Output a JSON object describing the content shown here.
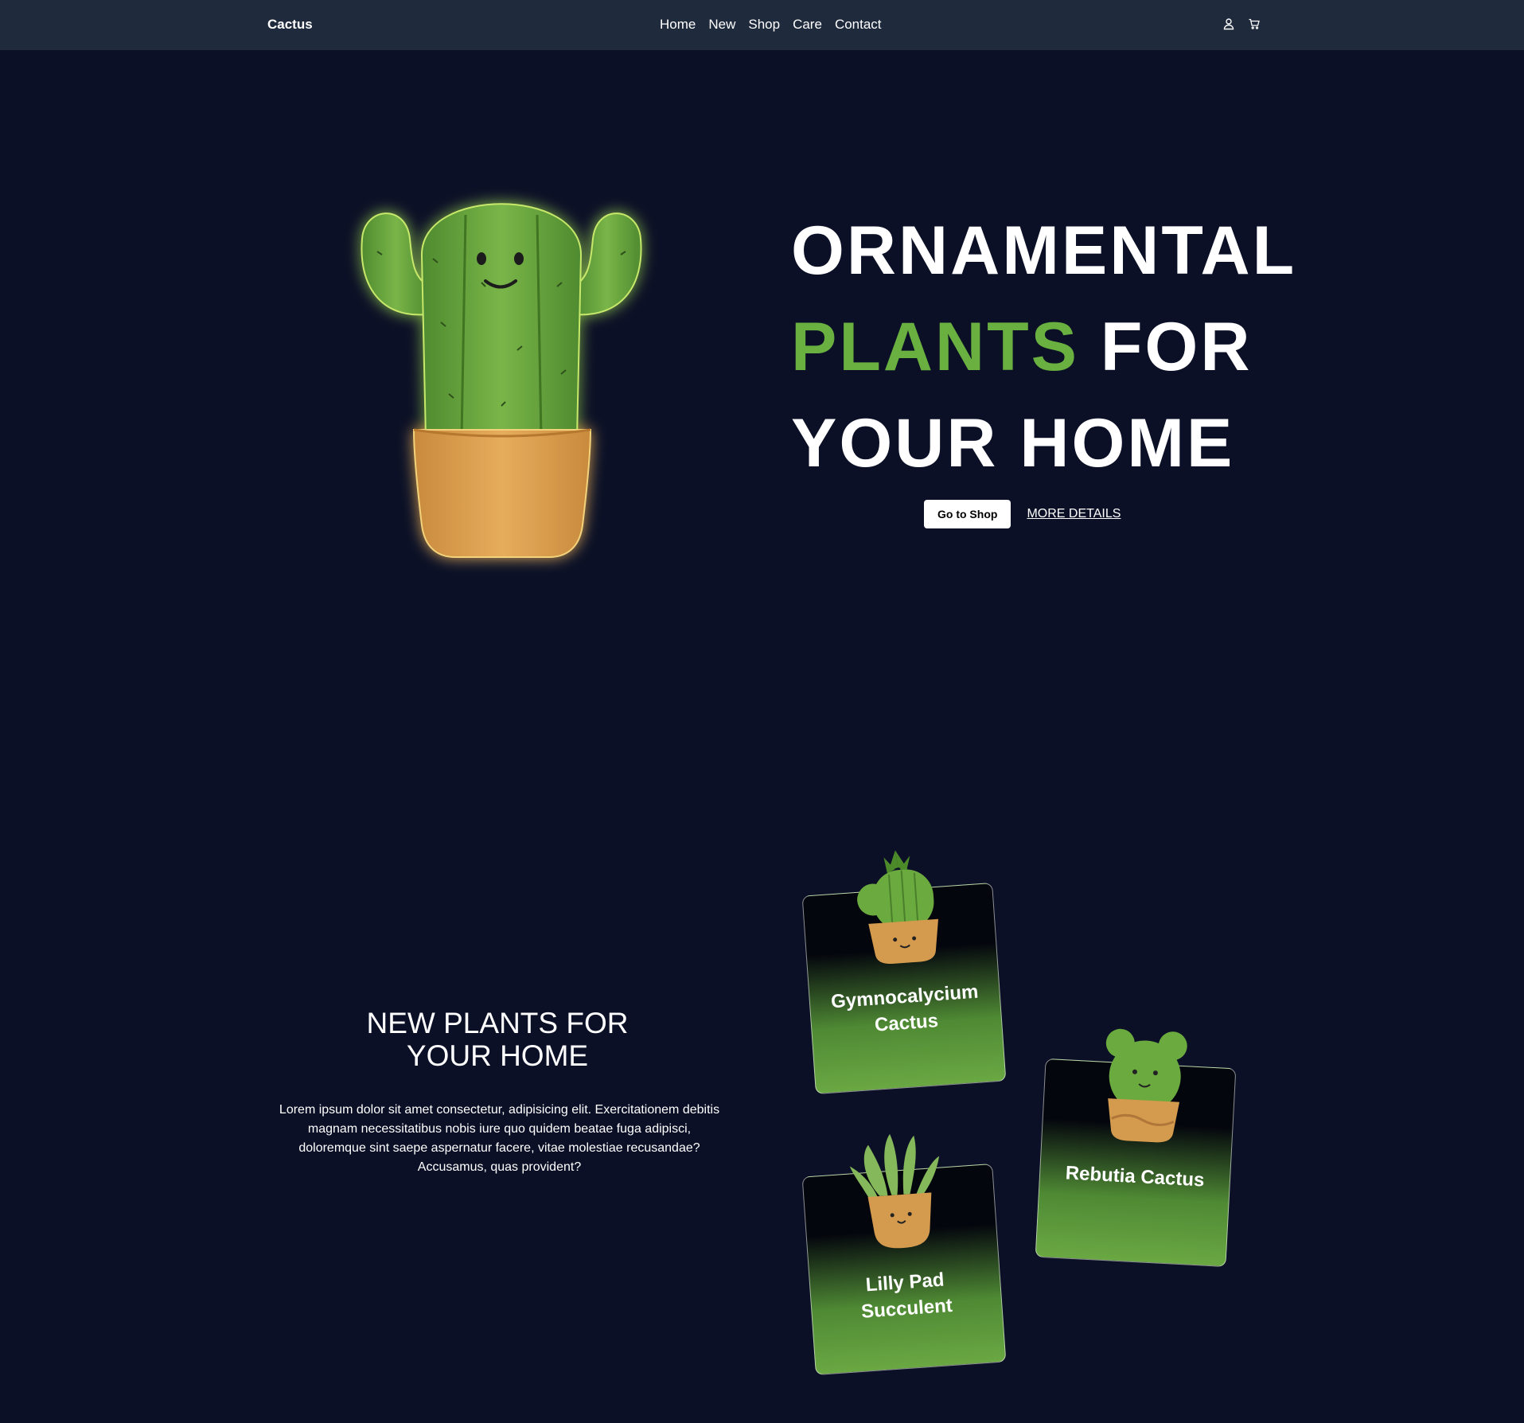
{
  "nav": {
    "logo": "Cactus",
    "links": [
      "Home",
      "New",
      "Shop",
      "Care",
      "Contact"
    ],
    "icons": [
      "user-icon",
      "cart-icon"
    ]
  },
  "hero": {
    "title_line1": "ORNAMENTAL",
    "title_accent": "PLANTS",
    "title_line2_rest": " FOR",
    "title_line3": "YOUR HOME",
    "shop_button": "Go to Shop",
    "more_link": "MORE DETAILS"
  },
  "section": {
    "title_line1": "NEW PLANTS FOR",
    "title_line2": "YOUR HOME",
    "text": "Lorem ipsum dolor sit amet consectetur, adipisicing elit. Exercitationem debitis magnam necessitatibus nobis iure quo quidem beatae fuga adipisci, doloremque sint saepe aspernatur facere, vitae molestiae recusandae? Accusamus, quas provident?"
  },
  "cards": [
    {
      "name": "Gymnocalycium Cactus"
    },
    {
      "name": "Rebutia Cactus"
    },
    {
      "name": "Lilly Pad Succulent"
    }
  ],
  "colors": {
    "background": "#0b1026",
    "navbar": "#1f2a3d",
    "accent": "#6ab041",
    "pot": "#d9a24f"
  }
}
